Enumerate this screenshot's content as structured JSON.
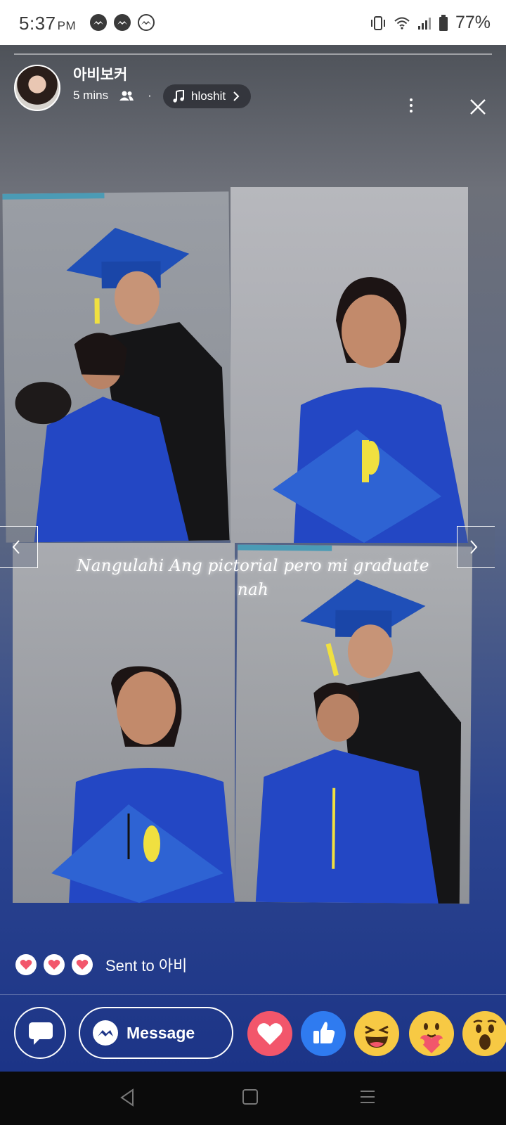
{
  "status_bar": {
    "time": "5:37",
    "ampm": "PM",
    "battery": "77%",
    "notification_icons": [
      "messenger-icon",
      "messenger-icon",
      "messenger-icon"
    ],
    "system_icons": [
      "vibrate-icon",
      "wifi-icon",
      "signal-icon",
      "battery-icon"
    ]
  },
  "story": {
    "username": "아비보커",
    "time_ago": "5 mins",
    "audience_icon": "friends-icon",
    "separator": "·",
    "music": {
      "icon": "music-note-icon",
      "label": "hloshit"
    },
    "caption": "Nangulahi Ang pictorial pero mi graduate nah",
    "photos": [
      "graduation-photo-1",
      "graduation-photo-2",
      "graduation-photo-3",
      "graduation-photo-4"
    ]
  },
  "reply": {
    "sent_text": "Sent to 아비",
    "sent_hearts": 3,
    "message_label": "Message",
    "reactions": [
      "love-reaction",
      "like-reaction",
      "haha-reaction",
      "care-reaction",
      "wow-reaction"
    ]
  },
  "colors": {
    "love": "#f2566b",
    "like": "#2f7bf0",
    "emoji": "#f7c944"
  }
}
